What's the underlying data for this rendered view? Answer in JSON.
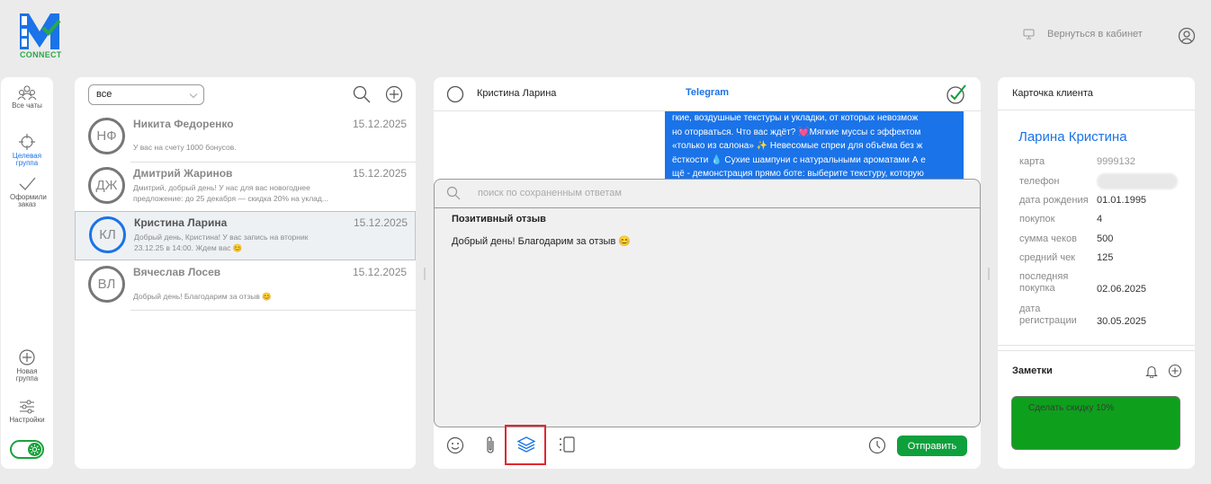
{
  "brand": {
    "logo_text": "CONNECT"
  },
  "topbar": {
    "back_label": "Вернуться в кабинет"
  },
  "nav": {
    "all_chats": "Все чаты",
    "target_group": "Целевая группа",
    "ordered": "Оформили заказ",
    "new_group": "Новая группа",
    "settings": "Настройки"
  },
  "chat_list": {
    "filter_value": "все",
    "chats": [
      {
        "initials": "НФ",
        "name": "Никита Федоренко",
        "date": "15.12.2025",
        "preview": "У вас на счету 1000 бонусов."
      },
      {
        "initials": "ДЖ",
        "name": "Дмитрий Жаринов",
        "date": "15.12.2025",
        "preview": "Дмитрий, добрый день! У нас для вас новогоднее предложение: до 25 декабря — скидка 20% на уклад..."
      },
      {
        "initials": "КЛ",
        "name": "Кристина Ларина",
        "date": "15.12.2025",
        "preview": "Добрый день, Кристина! У вас запись на вторник 23.12.25 в 14:00. Ждем вас 😊"
      },
      {
        "initials": "ВЛ",
        "name": "Вячеслав Лосев",
        "date": "15.12.2025",
        "preview": "Добрый день! Благодарим за отзыв 😊"
      }
    ]
  },
  "conversation": {
    "contact_name": "Кристина Ларина",
    "channel": "Telegram",
    "message_lines": [
      "гкие, воздушные текстуры и укладки, от которых невозмож",
      "но оторваться. Что вас ждёт? 💓Мягкие муссы с эффектом",
      "«только из салона» ✨ Невесомые спреи для объёма без ж",
      "ёсткости 💧 Сухие шампуни с натуральными ароматами А е",
      "щё - демонстрация прямо боте: выберите текстуру, которую"
    ],
    "quick_search_placeholder": "поиск по сохраненным ответам",
    "quick_reply_title": "Позитивный отзыв",
    "quick_reply_text": "Добрый день! Благодарим за отзыв 😊",
    "send_label": "Отправить"
  },
  "client_card": {
    "header": "Карточка клиента",
    "name": "Ларина Кристина",
    "fields": [
      {
        "label": "карта",
        "value": "9999132"
      },
      {
        "label": "телефон",
        "value": ""
      },
      {
        "label": "дата рождения",
        "value": "01.01.1995"
      },
      {
        "label": "покупок",
        "value": "4"
      },
      {
        "label": "сумма чеков",
        "value": "500"
      },
      {
        "label": "средний чек",
        "value": "125"
      },
      {
        "label": "последняя покупка",
        "value": "02.06.2025"
      },
      {
        "label": "дата регистрации",
        "value": "30.05.2025"
      }
    ],
    "notes_title": "Заметки",
    "note_text": "Сделать скидку 10%"
  },
  "colors": {
    "accent": "#1a73e8",
    "green": "#0ea03c",
    "highlight": "#e0282e"
  }
}
